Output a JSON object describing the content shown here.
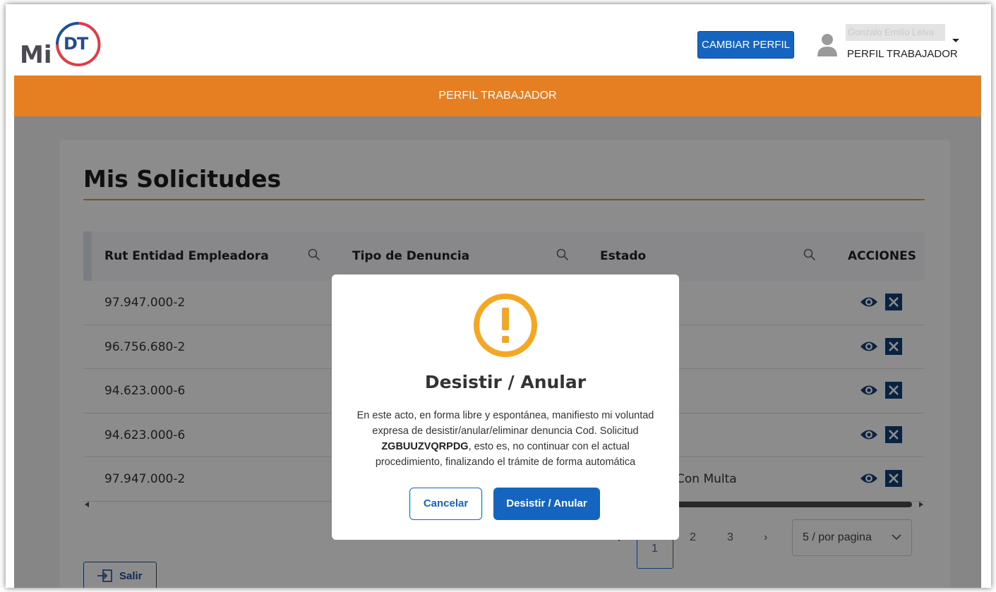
{
  "header": {
    "logo_prefix": "Mi",
    "logo_mark": "DT",
    "change_profile_label": "CAMBIAR PERFIL",
    "user_name": "Gonzalo Emilio Leiva",
    "user_profile": "PERFIL TRABAJADOR"
  },
  "banner": {
    "label": "PERFIL TRABAJADOR"
  },
  "page": {
    "title": "Mis Solicitudes"
  },
  "table": {
    "headers": [
      "Rut Entidad Empleadora",
      "Tipo de Denuncia",
      "Estado",
      "ACCIONES"
    ],
    "rows": [
      {
        "rut": "97.947.000-2",
        "tipo": "",
        "estado": ""
      },
      {
        "rut": "96.756.680-2",
        "tipo": "",
        "estado": ""
      },
      {
        "rut": "94.623.000-6",
        "tipo": "",
        "estado": ""
      },
      {
        "rut": "94.623.000-6",
        "tipo": "",
        "estado": ""
      },
      {
        "rut": "97.947.000-2",
        "tipo": "",
        "estado": "Con Multa"
      }
    ]
  },
  "pagination": {
    "prev": "‹",
    "pages": [
      "1",
      "2",
      "3"
    ],
    "next": "›",
    "current": "1",
    "per_page": "5 / por pagina"
  },
  "exit_label": "Salir",
  "modal": {
    "title": "Desistir / Anular",
    "body_part1": "En este acto, en forma libre y espontánea, manifiesto mi voluntad expresa de desistir/anular/eliminar denuncia Cod. Solicitud ",
    "code": "ZGBUUZVQRPDG",
    "body_part2": ", esto es, no continuar con el actual procedimiento, finalizando el trámite de forma automática",
    "cancel_label": "Cancelar",
    "confirm_label": "Desistir / Anular"
  },
  "colors": {
    "brand_blue": "#1565c0",
    "banner_orange": "#e67e22",
    "warning_orange": "#f5a623",
    "action_dark": "#123f73"
  }
}
